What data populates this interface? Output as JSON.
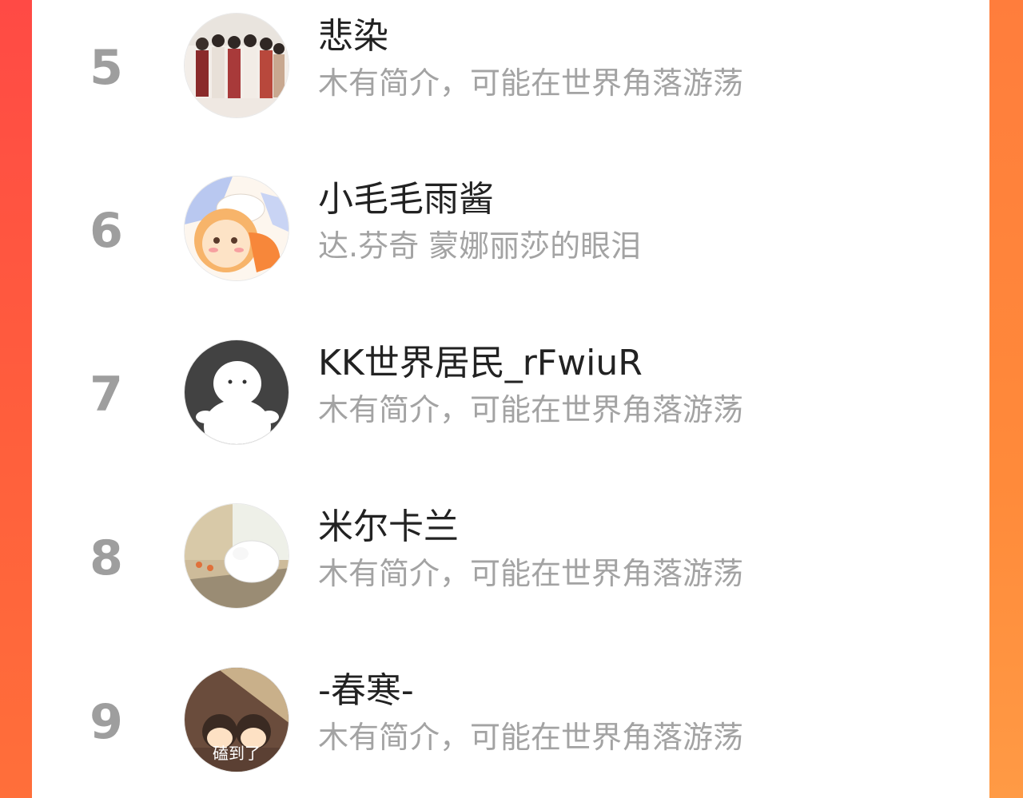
{
  "ranking": {
    "items": [
      {
        "rank": "5",
        "name": "悲染",
        "bio": "木有简介，可能在世界角落游荡",
        "avatar": "group-illustration-avatar"
      },
      {
        "rank": "6",
        "name": "小毛毛雨酱",
        "bio": "达.芬奇 蒙娜丽莎的眼泪",
        "avatar": "anime-girl-avatar"
      },
      {
        "rank": "7",
        "name": "KK世界居民_rFwiuR",
        "bio": "木有简介，可能在世界角落游荡",
        "avatar": "default-user-avatar"
      },
      {
        "rank": "8",
        "name": "米尔卡兰",
        "bio": "木有简介，可能在世界角落游荡",
        "avatar": "plush-toy-avatar"
      },
      {
        "rank": "9",
        "name": "-春寒-",
        "bio": "木有简介，可能在世界角落游荡",
        "avatar": "cartoon-couple-avatar",
        "avatar_caption": "磕到了"
      }
    ]
  },
  "colors": {
    "background_left": "#ff4a45",
    "background_right": "#ff8a3a",
    "rank": "#9e9e9e",
    "name": "#222222",
    "bio": "#a3a3a3"
  }
}
